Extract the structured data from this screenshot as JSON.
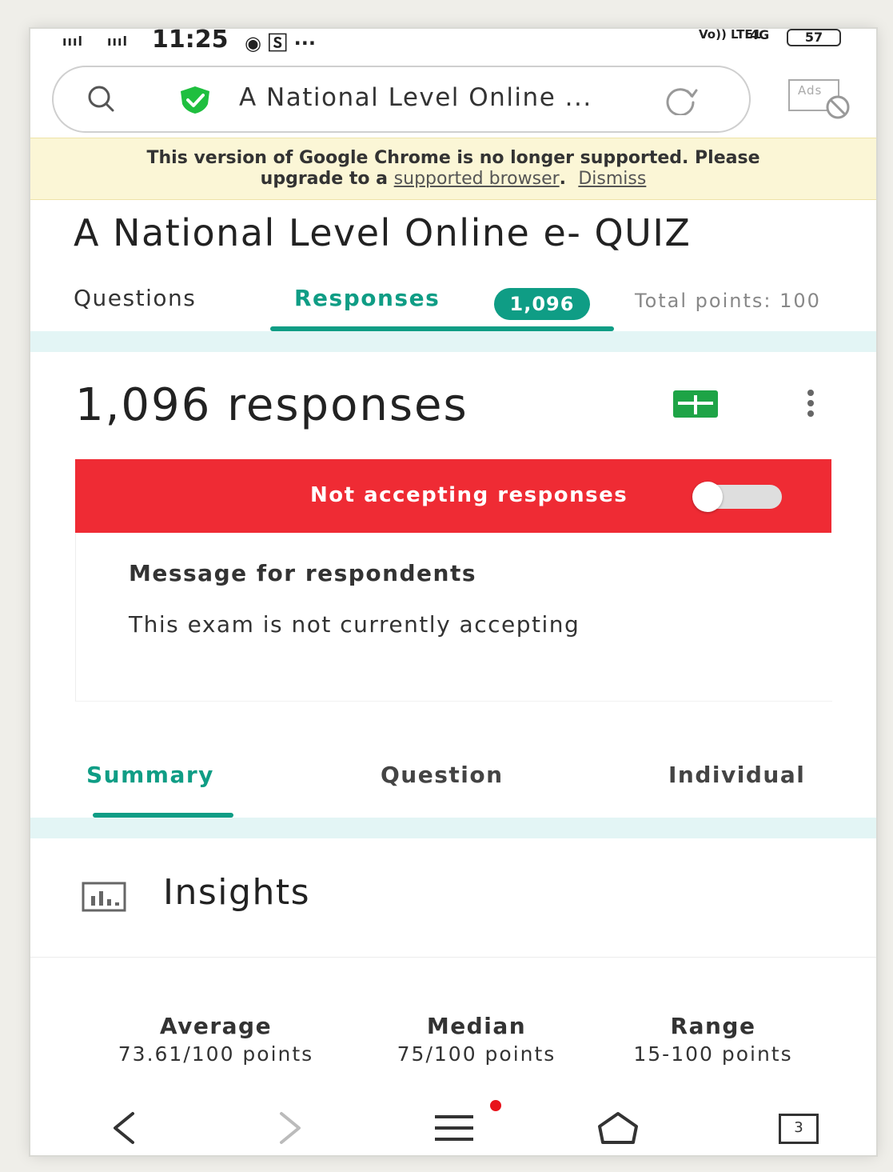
{
  "status_bar": {
    "signal1": "ıııl",
    "signal2": "ıııl",
    "time": "11:25",
    "icons": "◉ 🅂 ···",
    "lte": "Vo)) LTE1",
    "network": "4G",
    "battery": "57"
  },
  "browser": {
    "url_text": "A National Level Online ...",
    "ads_label": "Ads"
  },
  "banner": {
    "text_line1": "This version of Google Chrome is no longer supported. Please",
    "text_line2_prefix": "upgrade to a",
    "link_text": "supported browser",
    "period": ".",
    "dismiss": "Dismiss"
  },
  "form": {
    "title": "A National Level Online e- QUIZ",
    "tabs": {
      "questions": "Questions",
      "responses": "Responses",
      "responses_count": "1,096",
      "total_points": "Total points: 100"
    }
  },
  "responses": {
    "count_title": "1,096 responses",
    "not_accepting": "Not accepting responses",
    "accepting_on": false,
    "message_title": "Message for respondents",
    "message_body": "This exam is not currently accepting"
  },
  "subtabs": {
    "summary": "Summary",
    "question": "Question",
    "individual": "Individual"
  },
  "insights": {
    "title": "Insights",
    "stats": [
      {
        "label": "Average",
        "value": "73.61/100 points"
      },
      {
        "label": "Median",
        "value": "75/100 points"
      },
      {
        "label": "Range",
        "value": "15-100 points"
      }
    ]
  },
  "nav": {
    "tabs_count": "3"
  },
  "colors": {
    "accent": "#0f9d85",
    "alert": "#ef2b34",
    "banner_bg": "#fbf6d6",
    "shield": "#1fbf3f",
    "sheets": "#1ea446"
  }
}
